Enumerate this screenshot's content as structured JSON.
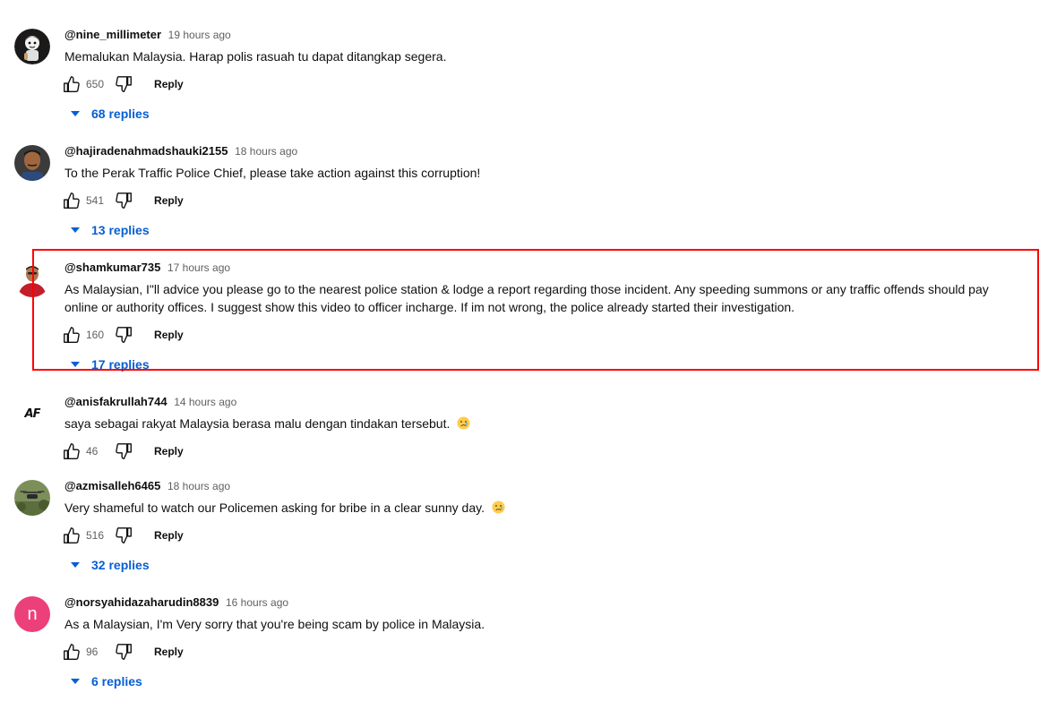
{
  "comments": [
    {
      "author": "@nine_millimeter",
      "time": "19 hours ago",
      "text": "Memalukan Malaysia. Harap polis rasuah tu dapat ditangkap segera.",
      "likes": "650",
      "reply_label": "Reply",
      "replies_label": "68 replies",
      "avatar": "cartoon-character-avatar"
    },
    {
      "author": "@hajiradenahmadshauki2155",
      "time": "18 hours ago",
      "text": "To the Perak Traffic Police Chief, please take action against this corruption!",
      "likes": "541",
      "reply_label": "Reply",
      "replies_label": "13 replies",
      "avatar": "man-photo-avatar"
    },
    {
      "author": "@shamkumar735",
      "time": "17 hours ago",
      "text_line1": "As Malaysian, I\"ll advice you please go to the nearest police station & lodge a report regarding those incident. Any speeding summons or any traffic offends should pay",
      "text_line2": "online or authority offices. I suggest show this video to officer incharge. If im not wrong, the police already started their investigation.",
      "likes": "160",
      "reply_label": "Reply",
      "replies_label": "17 replies",
      "avatar": "man-red-shirt-avatar"
    },
    {
      "author": "@anisfakrullah744",
      "time": "14 hours ago",
      "text": "saya sebagai rakyat Malaysia berasa malu dengan tindakan tersebut.",
      "likes": "46",
      "reply_label": "Reply",
      "avatar": "af-logo-avatar",
      "avatar_text": "AF"
    },
    {
      "author": "@azmisalleh6465",
      "time": "18 hours ago",
      "text": "Very shameful to watch our Policemen asking for bribe in a clear sunny day.",
      "likes": "516",
      "reply_label": "Reply",
      "replies_label": "32 replies",
      "avatar": "drone-photo-avatar"
    },
    {
      "author": "@norsyahidazaharudin8839",
      "time": "16 hours ago",
      "text": "As a Malaysian, I'm Very sorry that you're being scam by police in Malaysia.",
      "likes": "96",
      "reply_label": "Reply",
      "replies_label": "6 replies",
      "avatar": "letter-avatar",
      "avatar_text": "n",
      "avatar_color": "#ec407a"
    }
  ],
  "colors": {
    "link": "#065fd4",
    "highlight": "#ff0000",
    "secondary_text": "#606060"
  }
}
